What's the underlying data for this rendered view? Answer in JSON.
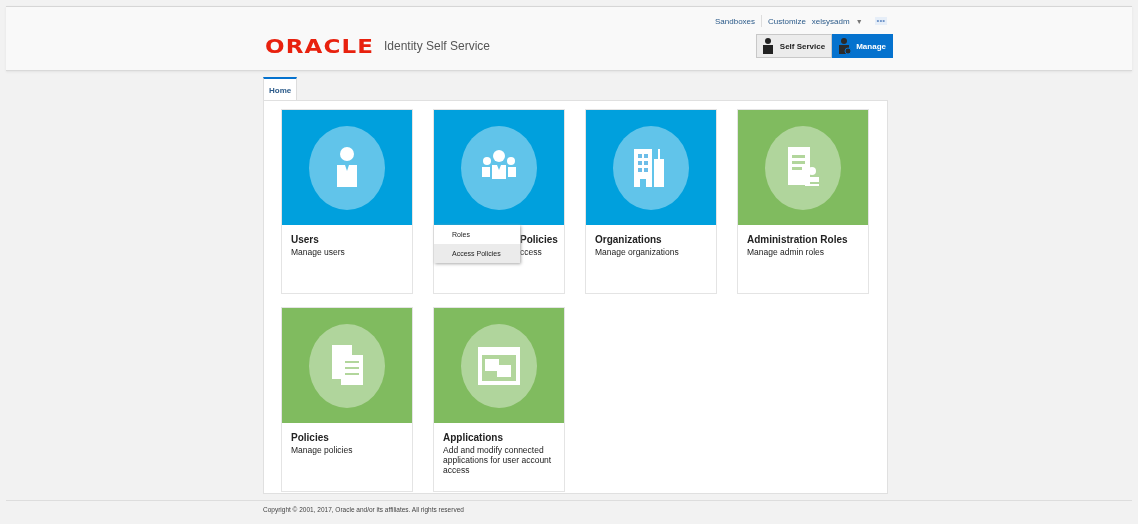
{
  "top_links": [
    {
      "label": "Sandboxes"
    },
    {
      "label": "Customize"
    }
  ],
  "user": {
    "name": "xelsysadm",
    "caret": "▼",
    "more": "•••"
  },
  "brand": {
    "logo": "ORACLE",
    "product": "Identity Self Service"
  },
  "mode_buttons": [
    {
      "label": "Self Service",
      "selected": false
    },
    {
      "label": "Manage",
      "selected": true
    }
  ],
  "tabs": [
    {
      "label": "Home",
      "selected": true
    }
  ],
  "cards": [
    {
      "kind": "normal",
      "color": "#00a0dd",
      "title": "Users",
      "lines": [
        "Manage users"
      ]
    },
    {
      "kind": "covered",
      "color": "#00a0dd",
      "title": "Policies",
      "lines": [
        "ccess"
      ]
    },
    {
      "kind": "normal",
      "color": "#00a0dd",
      "title": "Organizations",
      "lines": [
        "Manage organizations"
      ]
    },
    {
      "kind": "normal",
      "color": "#80bb5f",
      "title": "Administration Roles",
      "lines": [
        "Manage admin roles"
      ]
    },
    {
      "kind": "normal",
      "color": "#80bb5f",
      "title": "Policies",
      "lines": [
        "Manage policies"
      ]
    },
    {
      "kind": "normal",
      "color": "#80bb5f",
      "title": "Applications",
      "lines": [
        "Add and modify connected applications for user account access"
      ]
    }
  ],
  "popup_menu": {
    "items": [
      {
        "label": "Roles",
        "selected": false
      },
      {
        "label": "Access Policies",
        "selected": true
      }
    ]
  },
  "footer": "Copyright © 2001, 2017, Oracle and/or its affiliates. All rights reserved"
}
